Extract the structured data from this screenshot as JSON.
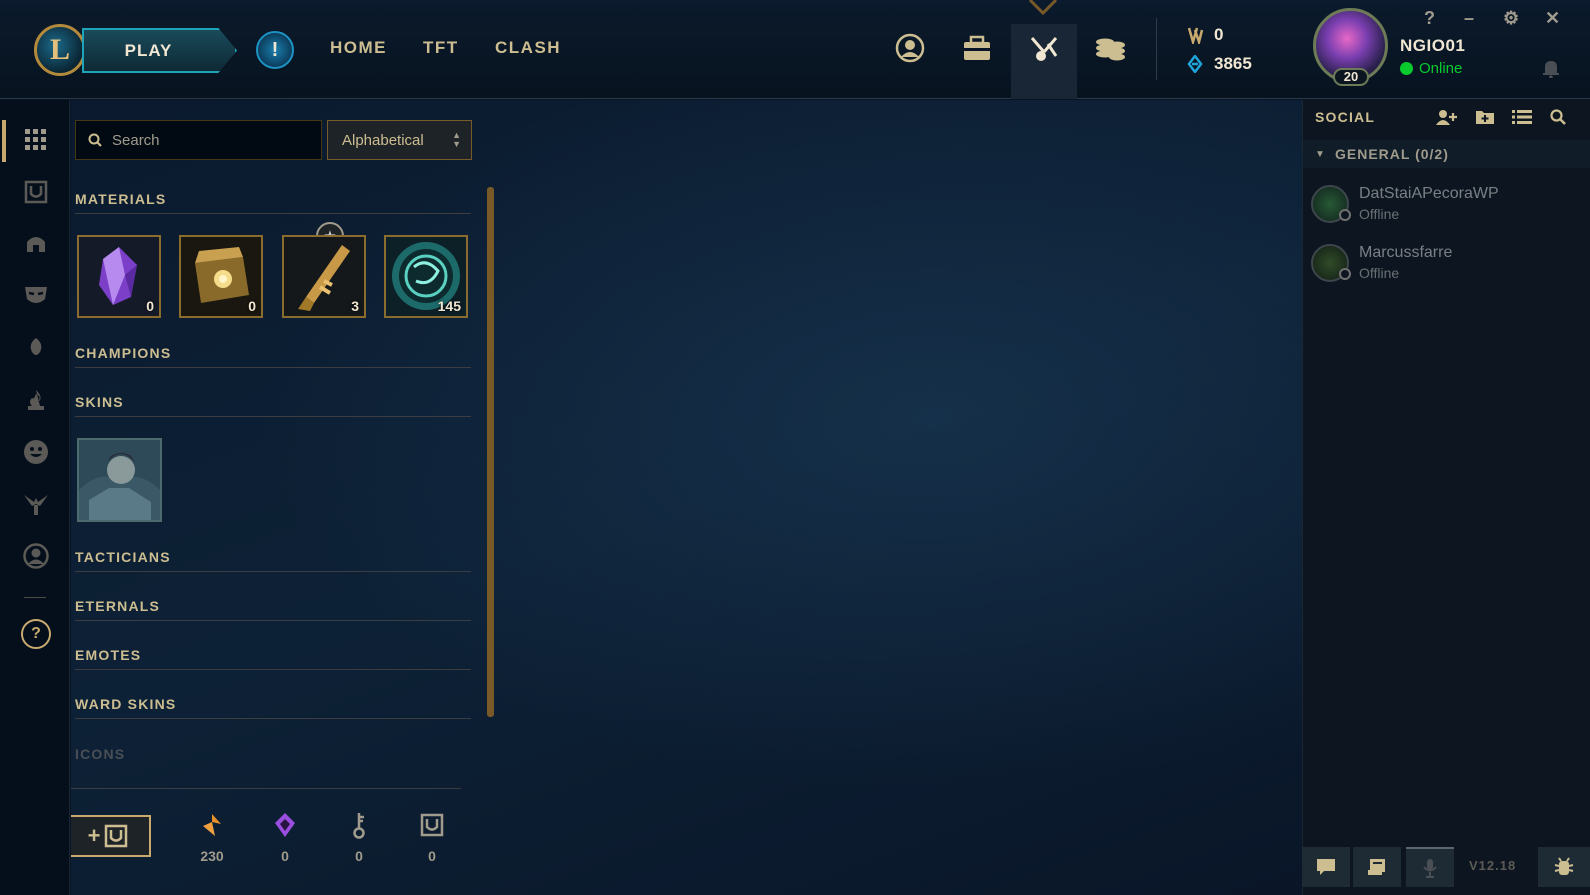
{
  "topbar": {
    "logo_letter": "L",
    "play_label": "PLAY",
    "alert_label": "!",
    "nav": [
      "HOME",
      "TFT",
      "CLASH"
    ],
    "icons": [
      "profile-icon",
      "collection-icon",
      "loot-icon",
      "store-icon"
    ],
    "currency": {
      "be": "0",
      "rp": "3865"
    },
    "summoner": {
      "name": "NGIO01",
      "status": "Online",
      "level": "20"
    },
    "window_controls": [
      "?",
      "–",
      "⚙",
      "✕"
    ]
  },
  "leftrail": {
    "items": [
      "grid-icon",
      "chest-icon",
      "helmet-icon",
      "mask-icon",
      "spirit-icon",
      "flame-icon",
      "emote-icon",
      "ward-icon",
      "user-icon"
    ],
    "help": "?"
  },
  "loot": {
    "search_placeholder": "Search",
    "sort_value": "Alphabetical",
    "sections": [
      "MATERIALS",
      "CHAMPIONS",
      "SKINS",
      "TACTICIANS",
      "ETERNALS",
      "EMOTES",
      "WARD SKINS",
      "ICONS"
    ],
    "materials": [
      {
        "name": "gemstone",
        "count": "0"
      },
      {
        "name": "masterwork-chest",
        "count": "0"
      },
      {
        "name": "key-fragment",
        "count": "3"
      },
      {
        "name": "mythic-token",
        "count": "145"
      }
    ],
    "craft_label": "+",
    "wallet": [
      {
        "icon": "orange-essence-icon",
        "value": "230"
      },
      {
        "icon": "mythic-essence-icon",
        "value": "0"
      },
      {
        "icon": "key-icon",
        "value": "0"
      },
      {
        "icon": "chest-icon",
        "value": "0"
      }
    ]
  },
  "social": {
    "title": "SOCIAL",
    "group": "GENERAL (0/2)",
    "friends": [
      {
        "name": "DatStaiAPecoraWP",
        "status": "Offline"
      },
      {
        "name": "Marcussfarre",
        "status": "Offline"
      }
    ],
    "version": "V12.18"
  },
  "colors": {
    "gold": "#c8aa6e",
    "online": "#0acb2d",
    "bg": "#0a1428"
  }
}
